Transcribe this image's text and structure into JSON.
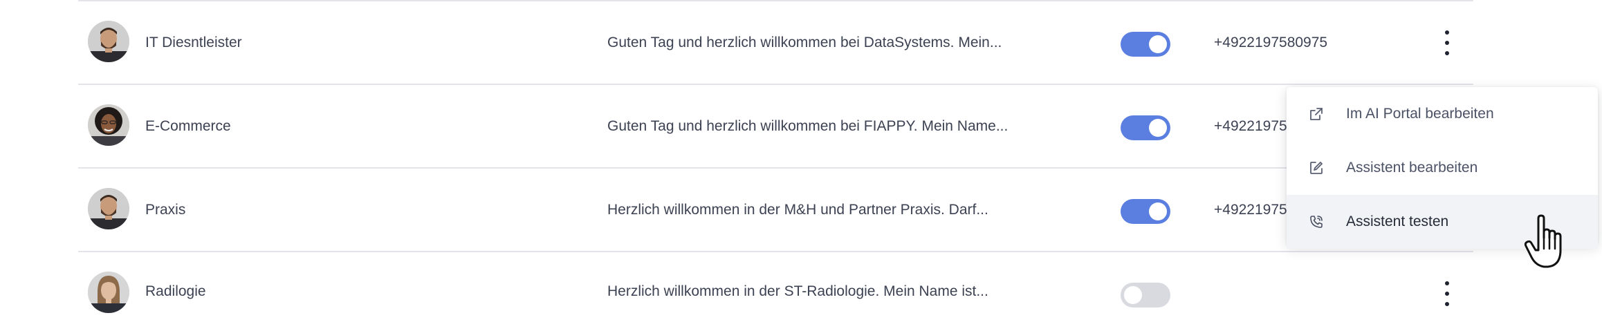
{
  "rows": [
    {
      "name": "IT Diesntleister",
      "greeting": "Guten Tag und herzlich willkommen bei DataSystems. Mein...",
      "active": true,
      "phone": "+4922197580975",
      "avatar": "avatar-man-bearded"
    },
    {
      "name": "E-Commerce",
      "greeting": "Guten Tag und herzlich willkommen bei FIAPPY. Mein Name...",
      "active": true,
      "phone": "+49221975",
      "avatar": "avatar-woman-curly"
    },
    {
      "name": "Praxis",
      "greeting": "Herzlich willkommen in der M&H und Partner Praxis. Darf...",
      "active": true,
      "phone": "+49221975",
      "avatar": "avatar-man-bearded"
    },
    {
      "name": "Radilogie",
      "greeting": "Herzlich willkommen in der ST-Radiologie. Mein Name ist...",
      "active": false,
      "phone": "",
      "avatar": "avatar-woman-blond"
    }
  ],
  "menu": {
    "items": [
      {
        "label": "Im AI Portal bearbeiten",
        "icon": "external-link-icon"
      },
      {
        "label": "Assistent bearbeiten",
        "icon": "edit-icon"
      },
      {
        "label": "Assistent testen",
        "icon": "phone-call-icon"
      }
    ],
    "active_index": 2
  },
  "colors": {
    "toggle_on": "#5b7fe0",
    "toggle_off": "#d9dadf",
    "text": "#3d4253",
    "divider": "#e3e4e8"
  }
}
